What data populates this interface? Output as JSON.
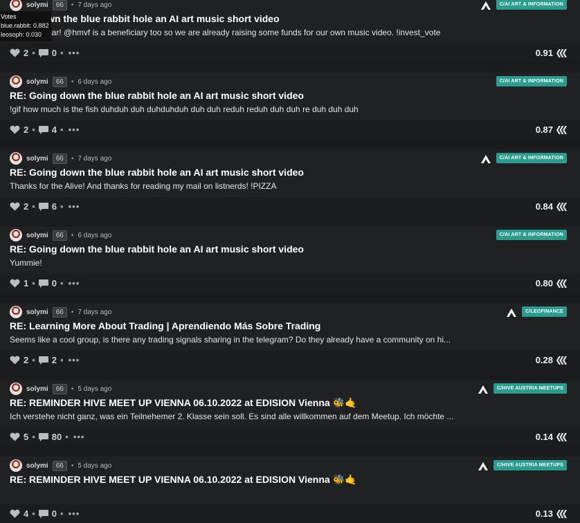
{
  "tooltip": {
    "title": "Votes",
    "voters": [
      "blue.rabbit: 0.882",
      "leosoph: 0.030"
    ]
  },
  "posts": [
    {
      "author": "solymi",
      "rep": "66",
      "sep": "•",
      "time": "7 days ago",
      "title": "RE: Going down the blue rabbit hole an AI art music short video",
      "title_visible": "down the blue rabbit hole an AI art music short video",
      "excerpt": "Yeah! @hmvf is a beneficiary too so we are already raising some funds for our own music video. !invest_vote",
      "excerpt_visible": "ear! @hmvf is a beneficiary too so we are already raising some funds for our own music video. !invest_vote",
      "community": "C/AI ART & INFORMATION",
      "leo_icon": true,
      "votes": "2",
      "comments": "0",
      "payout": "0.91"
    },
    {
      "author": "solymi",
      "rep": "66",
      "sep": "•",
      "time": "6 days ago",
      "title": "RE: Going down the blue rabbit hole an AI art music short video",
      "excerpt": "!gif how much is the fish duhduh duh duhduhduh duh duh reduh reduh duh duh re duh duh duh",
      "community": "C/AI ART & INFORMATION",
      "leo_icon": false,
      "votes": "2",
      "comments": "4",
      "payout": "0.87"
    },
    {
      "author": "solymi",
      "rep": "66",
      "sep": "•",
      "time": "7 days ago",
      "title": "RE: Going down the blue rabbit hole an AI art music short video",
      "excerpt": "Thanks for the Alive! And thanks for reading my mail on listnerds! !PIZZA",
      "community": "C/AI ART & INFORMATION",
      "leo_icon": true,
      "votes": "2",
      "comments": "6",
      "payout": "0.84"
    },
    {
      "author": "solymi",
      "rep": "66",
      "sep": "•",
      "time": "6 days ago",
      "title": "RE: Going down the blue rabbit hole an AI art music short video",
      "excerpt": "Yummie!",
      "community": "C/AI ART & INFORMATION",
      "leo_icon": false,
      "votes": "1",
      "comments": "0",
      "payout": "0.80"
    },
    {
      "author": "solymi",
      "rep": "66",
      "sep": "•",
      "time": "7 days ago",
      "title": "RE: Learning More About Trading | Aprendiendo Más Sobre Trading",
      "excerpt": "Seems like a cool group, is there any trading signals sharing in the telegram? Do they already have a community on hi...",
      "community": "C/LEOFINANCE",
      "leo_icon": true,
      "votes": "2",
      "comments": "2",
      "payout": "0.28"
    },
    {
      "author": "solymi",
      "rep": "66",
      "sep": "•",
      "time": "5 days ago",
      "title": "RE: REMINDER HIVE MEET UP VIENNA 06.10.2022 at EDISION Vienna 🐝🤙",
      "excerpt": "Ich verstehe nicht ganz, was ein Teilnehemer 2. Klasse sein soll. Es sind alle willkommen auf dem Meetup. Ich möchte ...",
      "community": "C/HIVE AUSTRIA MEETUPS",
      "leo_icon": true,
      "votes": "5",
      "comments": "80",
      "payout": "0.14"
    },
    {
      "author": "solymi",
      "rep": "66",
      "sep": "•",
      "time": "5 days ago",
      "title": "RE: REMINDER HIVE MEET UP VIENNA 06.10.2022 at EDISION Vienna 🐝🤙",
      "excerpt": "",
      "community": "C/HIVE AUSTRIA MEETUPS",
      "leo_icon": true,
      "votes": "4",
      "comments": "0",
      "payout": "0.13"
    }
  ],
  "labels": {
    "more": "•••"
  }
}
